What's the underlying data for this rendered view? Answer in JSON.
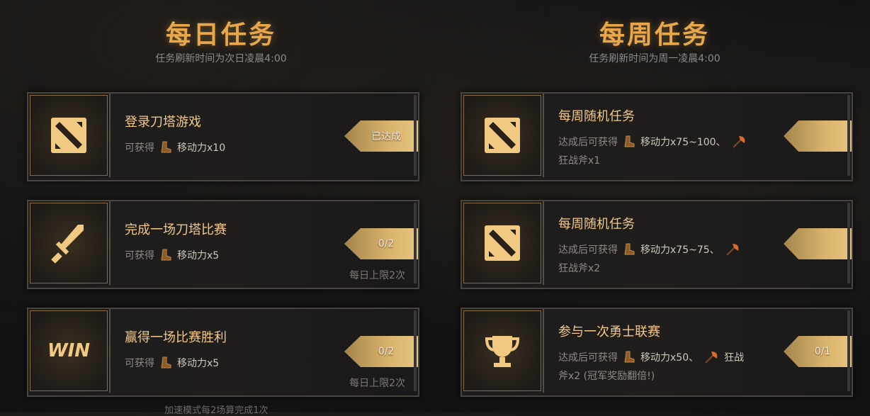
{
  "daily": {
    "title": "每日任务",
    "subtitle": "任务刷新时间为次日凌晨4:00",
    "tasks": [
      {
        "icon": "dota-logo-icon",
        "title": "登录刀塔游戏",
        "reward_prefix": "可获得",
        "reward": "移动力x10",
        "status": "已达成",
        "limit": ""
      },
      {
        "icon": "sword-icon",
        "title": "完成一场刀塔比赛",
        "reward_prefix": "可获得",
        "reward": "移动力x5",
        "status": "0/2",
        "limit": "每日上限2次"
      },
      {
        "icon": "win-icon",
        "title": "赢得一场比赛胜利",
        "reward_prefix": "可获得",
        "reward": "移动力x5",
        "status": "0/2",
        "limit": "每日上限2次"
      }
    ],
    "footnote": "加速模式每2场算完成1次",
    "win_text": "WIN"
  },
  "weekly": {
    "title": "每周任务",
    "subtitle": "任务刷新时间为周一凌晨4:00",
    "tasks": [
      {
        "icon": "dota-logo-icon",
        "title": "每周随机任务",
        "reward_prefix": "达成后可获得",
        "reward": "移动力x75~100、",
        "reward2": "狂战斧x1",
        "status": ""
      },
      {
        "icon": "dota-logo-icon",
        "title": "每周随机任务",
        "reward_prefix": "达成后可获得",
        "reward": "移动力x75~75、",
        "reward2": "狂战斧x2",
        "status": ""
      },
      {
        "icon": "trophy-icon",
        "title": "参与一次勇士联赛",
        "reward_prefix": "达成后可获得",
        "reward": "移动力x50、",
        "reward_tail": "狂战",
        "reward2": "斧x2 (冠军奖励翻倍!)",
        "status": "0/1"
      }
    ]
  },
  "colors": {
    "accent": "#e9a74c",
    "gold_tag": "#d9b36c",
    "bg": "#121214"
  }
}
